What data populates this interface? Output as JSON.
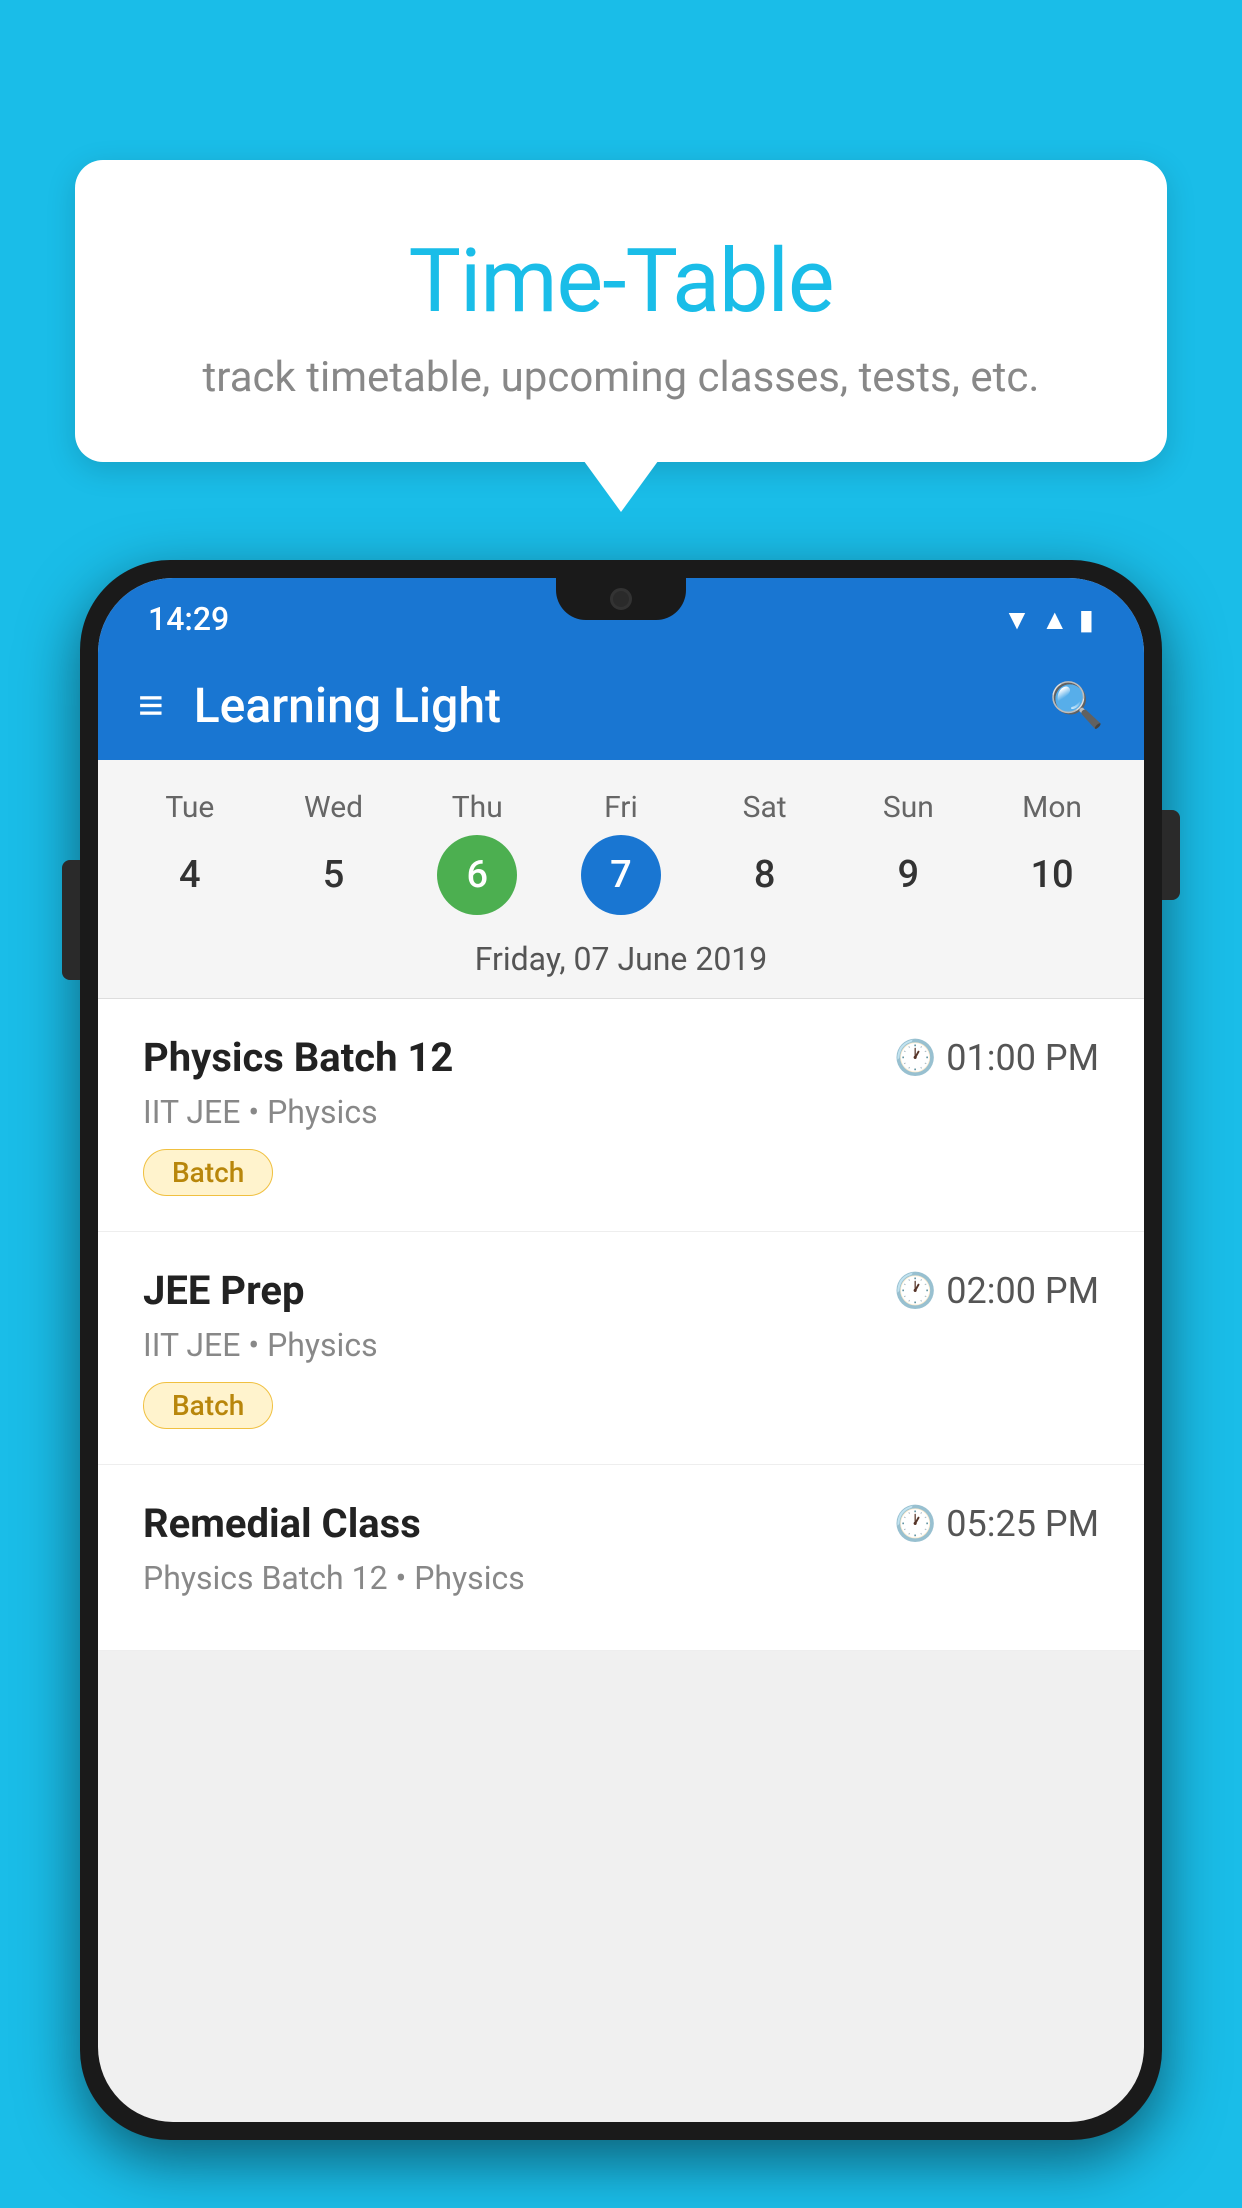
{
  "background_color": "#1ABDE8",
  "tooltip": {
    "title": "Time-Table",
    "subtitle": "track timetable, upcoming classes, tests, etc."
  },
  "phone": {
    "status_bar": {
      "time": "14:29",
      "icons": [
        "wifi",
        "signal",
        "battery"
      ]
    },
    "app_bar": {
      "title": "Learning Light"
    },
    "calendar": {
      "days": [
        {
          "label": "Tue",
          "number": "4",
          "state": "normal"
        },
        {
          "label": "Wed",
          "number": "5",
          "state": "normal"
        },
        {
          "label": "Thu",
          "number": "6",
          "state": "today"
        },
        {
          "label": "Fri",
          "number": "7",
          "state": "selected"
        },
        {
          "label": "Sat",
          "number": "8",
          "state": "normal"
        },
        {
          "label": "Sun",
          "number": "9",
          "state": "normal"
        },
        {
          "label": "Mon",
          "number": "10",
          "state": "normal"
        }
      ],
      "selected_date": "Friday, 07 June 2019"
    },
    "schedule": [
      {
        "name": "Physics Batch 12",
        "time": "01:00 PM",
        "sub": "IIT JEE • Physics",
        "badge": "Batch"
      },
      {
        "name": "JEE Prep",
        "time": "02:00 PM",
        "sub": "IIT JEE • Physics",
        "badge": "Batch"
      },
      {
        "name": "Remedial Class",
        "time": "05:25 PM",
        "sub": "Physics Batch 12 • Physics",
        "badge": null
      }
    ]
  }
}
